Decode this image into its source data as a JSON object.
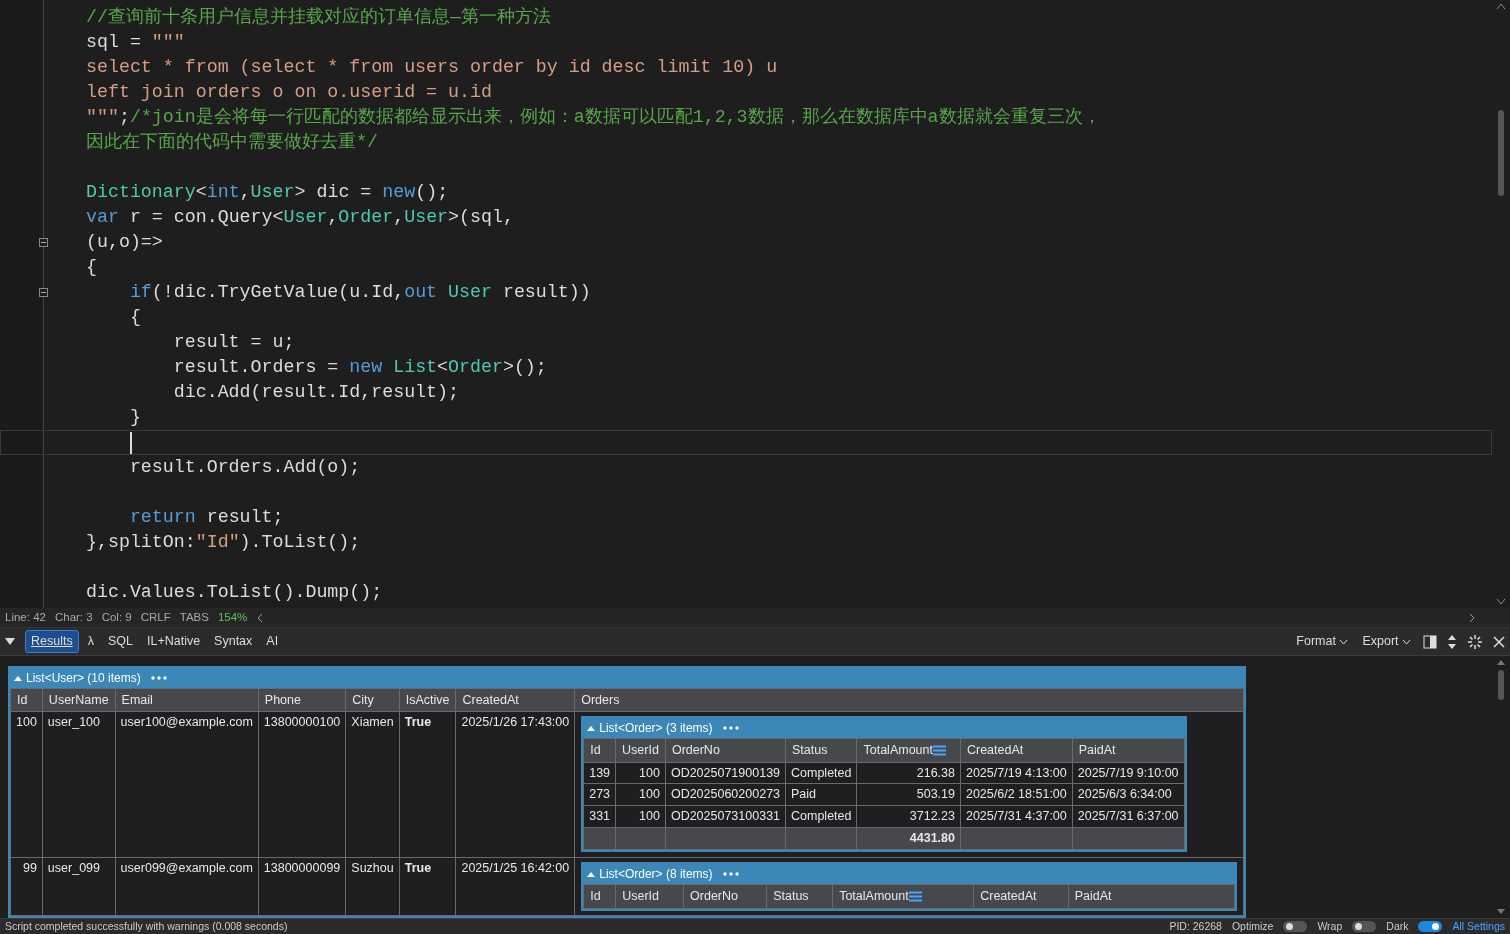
{
  "editor": {
    "lines": [
      {
        "fold": false,
        "current": false,
        "tokens": [
          {
            "kind": "comment",
            "text": "//查询前十条用户信息并挂载对应的订单信息—第一种方法"
          }
        ]
      },
      {
        "fold": false,
        "current": false,
        "tokens": [
          {
            "kind": "plain",
            "text": "sql = "
          },
          {
            "kind": "string",
            "text": "\"\"\""
          }
        ]
      },
      {
        "fold": false,
        "current": false,
        "tokens": [
          {
            "kind": "string",
            "text": "select * from (select * from users order by id desc limit 10) u"
          }
        ]
      },
      {
        "fold": false,
        "current": false,
        "tokens": [
          {
            "kind": "string",
            "text": "left join orders o on o.userid = u.id"
          }
        ]
      },
      {
        "fold": false,
        "current": false,
        "tokens": [
          {
            "kind": "string",
            "text": "\"\"\""
          },
          {
            "kind": "plain",
            "text": ";"
          },
          {
            "kind": "comment",
            "text": "/*join是会将每一行匹配的数据都给显示出来，例如：a数据可以匹配1,2,3数据，那么在数据库中a数据就会重复三次，"
          }
        ]
      },
      {
        "fold": false,
        "current": false,
        "tokens": [
          {
            "kind": "comment",
            "text": "因此在下面的代码中需要做好去重*/"
          }
        ]
      },
      {
        "fold": false,
        "current": false
      },
      {
        "fold": false,
        "current": false,
        "tokens": [
          {
            "kind": "type",
            "text": "Dictionary"
          },
          {
            "kind": "plain",
            "text": "<"
          },
          {
            "kind": "keyword",
            "text": "int"
          },
          {
            "kind": "plain",
            "text": ","
          },
          {
            "kind": "type",
            "text": "User"
          },
          {
            "kind": "plain",
            "text": "> dic = "
          },
          {
            "kind": "keyword",
            "text": "new"
          },
          {
            "kind": "plain",
            "text": "();"
          }
        ]
      },
      {
        "fold": false,
        "current": false,
        "tokens": [
          {
            "kind": "keyword",
            "text": "var"
          },
          {
            "kind": "plain",
            "text": " r = con.Query<"
          },
          {
            "kind": "type",
            "text": "User"
          },
          {
            "kind": "plain",
            "text": ","
          },
          {
            "kind": "type",
            "text": "Order"
          },
          {
            "kind": "plain",
            "text": ","
          },
          {
            "kind": "type",
            "text": "User"
          },
          {
            "kind": "plain",
            "text": ">(sql,"
          }
        ]
      },
      {
        "fold": true,
        "current": false,
        "tokens": [
          {
            "kind": "plain",
            "text": "(u,o)=>"
          }
        ]
      },
      {
        "fold": false,
        "current": false,
        "tokens": [
          {
            "kind": "plain",
            "text": "{"
          }
        ]
      },
      {
        "fold": true,
        "current": false,
        "tokens": [
          {
            "kind": "keyword",
            "text": "    if"
          },
          {
            "kind": "plain",
            "text": "(!dic.TryGetValue(u.Id,"
          },
          {
            "kind": "keyword",
            "text": "out "
          },
          {
            "kind": "type",
            "text": "User"
          },
          {
            "kind": "plain",
            "text": " result))"
          }
        ]
      },
      {
        "fold": false,
        "current": false,
        "tokens": [
          {
            "kind": "plain",
            "text": "    {"
          }
        ]
      },
      {
        "fold": false,
        "current": false,
        "tokens": [
          {
            "kind": "plain",
            "text": "        result = u;"
          }
        ]
      },
      {
        "fold": false,
        "current": false,
        "tokens": [
          {
            "kind": "plain",
            "text": "        result.Orders = "
          },
          {
            "kind": "keyword",
            "text": "new "
          },
          {
            "kind": "type",
            "text": "List"
          },
          {
            "kind": "plain",
            "text": "<"
          },
          {
            "kind": "type",
            "text": "Order"
          },
          {
            "kind": "plain",
            "text": ">();"
          }
        ]
      },
      {
        "fold": false,
        "current": false,
        "tokens": [
          {
            "kind": "plain",
            "text": "        dic.Add(result.Id,result);"
          }
        ]
      },
      {
        "fold": false,
        "current": false,
        "tokens": [
          {
            "kind": "plain",
            "text": "    }"
          }
        ]
      },
      {
        "fold": false,
        "current": true
      },
      {
        "fold": false,
        "current": false,
        "tokens": [
          {
            "kind": "plain",
            "text": "    result.Orders.Add(o);"
          }
        ]
      },
      {
        "fold": false,
        "current": false
      },
      {
        "fold": false,
        "current": false,
        "tokens": [
          {
            "kind": "keyword",
            "text": "    return"
          },
          {
            "kind": "plain",
            "text": " result;"
          }
        ]
      },
      {
        "fold": false,
        "current": false,
        "tokens": [
          {
            "kind": "plain",
            "text": "},splitOn:"
          },
          {
            "kind": "string",
            "text": "\"Id\""
          },
          {
            "kind": "plain",
            "text": ").ToList();"
          }
        ]
      },
      {
        "fold": false,
        "current": false
      },
      {
        "fold": false,
        "current": false,
        "tokens": [
          {
            "kind": "plain",
            "text": "dic.Values.ToList().Dump();"
          }
        ]
      }
    ],
    "status": [
      "Line: 42",
      "Char: 3",
      "Col: 9",
      "CRLF",
      "TABS"
    ],
    "zoom": "154%"
  },
  "results": {
    "tabs": [
      {
        "label": "Results",
        "selected": true
      },
      {
        "label": "λ",
        "selected": false
      },
      {
        "label": "SQL",
        "selected": false
      },
      {
        "label": "IL+Native",
        "selected": false
      },
      {
        "label": "Syntax",
        "selected": false
      },
      {
        "label": "AI",
        "selected": false
      }
    ],
    "menus": [
      "Format",
      "Export"
    ],
    "list": {
      "title": "List<User> (10 items)",
      "columns": [
        {
          "label": "Id",
          "kind": "number"
        },
        {
          "label": "UserName",
          "kind": "text"
        },
        {
          "label": "Email",
          "kind": "text"
        },
        {
          "label": "Phone",
          "kind": "text"
        },
        {
          "label": "City",
          "kind": "text"
        },
        {
          "label": "IsActive",
          "kind": "bool"
        },
        {
          "label": "CreatedAt",
          "kind": "text"
        },
        {
          "label": "Orders",
          "kind": "list"
        }
      ],
      "rows": [
        {
          "cells": [
            "100",
            "user_100",
            "user100@example.com",
            "13800000100",
            "Xiamen",
            "True",
            "2025/1/26 17:43:00"
          ],
          "orders": {
            "title": "List<Order> (3 items)",
            "columns": [
              {
                "label": "Id",
                "kind": "text",
                "summed": false
              },
              {
                "label": "UserId",
                "kind": "number",
                "summed": false
              },
              {
                "label": "OrderNo",
                "kind": "text",
                "summed": false
              },
              {
                "label": "Status",
                "kind": "text",
                "summed": false
              },
              {
                "label": "TotalAmount",
                "kind": "number",
                "summed": true
              },
              {
                "label": "CreatedAt",
                "kind": "text",
                "summed": false
              },
              {
                "label": "PaidAt",
                "kind": "text",
                "summed": false
              }
            ],
            "rows": [
              [
                "139",
                "100",
                "OD2025071900139",
                "Completed",
                "216.38",
                "2025/7/19 4:13:00",
                "2025/7/19 9:10:00"
              ],
              [
                "273",
                "100",
                "OD2025060200273",
                "Paid",
                "503.19",
                "2025/6/2 18:51:00",
                "2025/6/3 6:34:00"
              ],
              [
                "331",
                "100",
                "OD2025073100331",
                "Completed",
                "3712.23",
                "2025/7/31 4:37:00",
                "2025/7/31 6:37:00"
              ]
            ],
            "total": "4431.80"
          }
        },
        {
          "cells": [
            "99",
            "user_099",
            "user099@example.com",
            "13800000099",
            "Suzhou",
            "True",
            "2025/1/25 16:42:00"
          ],
          "orders": {
            "title": "List<Order> (8 items)",
            "columns": [
              {
                "label": "Id",
                "summed": false
              },
              {
                "label": "UserId",
                "summed": false
              },
              {
                "label": "OrderNo",
                "summed": false
              },
              {
                "label": "Status",
                "summed": false
              },
              {
                "label": "TotalAmount",
                "summed": true
              },
              {
                "label": "CreatedAt",
                "summed": false
              },
              {
                "label": "PaidAt",
                "summed": false
              }
            ]
          }
        }
      ]
    }
  },
  "status_bar": {
    "message": "Script completed successfully with warnings (0.008 seconds)",
    "pid": "PID: 26268",
    "toggles": [
      {
        "label": "Optimize",
        "on": false
      },
      {
        "label": "Wrap",
        "on": false
      },
      {
        "label": "Dark",
        "on": true
      }
    ],
    "link": "All Settings"
  }
}
